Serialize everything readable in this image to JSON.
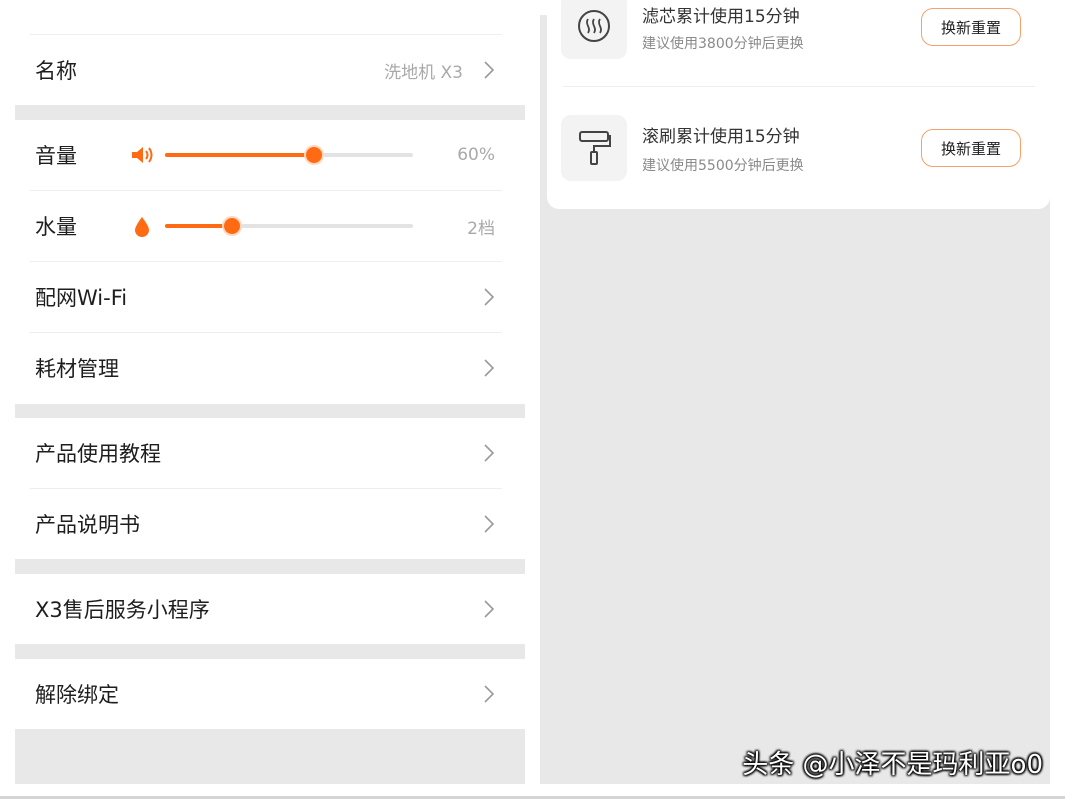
{
  "settings": {
    "name_row": {
      "label": "名称",
      "value": "洗地机 X3"
    },
    "volume": {
      "label": "音量",
      "value_text": "60%",
      "level": 0.6,
      "icon": "speaker-icon"
    },
    "water": {
      "label": "水量",
      "value_text": "2档",
      "level": 0.27,
      "icon": "water-drop-icon"
    },
    "wifi": {
      "label": "配网Wi-Fi"
    },
    "consumables": {
      "label": "耗材管理"
    },
    "tutorial": {
      "label": "产品使用教程"
    },
    "manual": {
      "label": "产品说明书"
    },
    "after_sales": {
      "label": "X3售后服务小程序"
    },
    "unbind": {
      "label": "解除绑定"
    }
  },
  "consumables_panel": {
    "items": [
      {
        "title": "滤芯累计使用15分钟",
        "subtitle": "建议使用3800分钟后更换",
        "button": "换新重置",
        "icon": "filter-icon"
      },
      {
        "title": "滚刷累计使用15分钟",
        "subtitle": "建议使用5500分钟后更换",
        "button": "换新重置",
        "icon": "roller-brush-icon"
      }
    ]
  },
  "watermark": "头条 @小泽不是玛利亚o0",
  "colors": {
    "accent": "#ff6a13",
    "background_gray": "#e8e8e8",
    "button_border": "#f4a26a"
  }
}
